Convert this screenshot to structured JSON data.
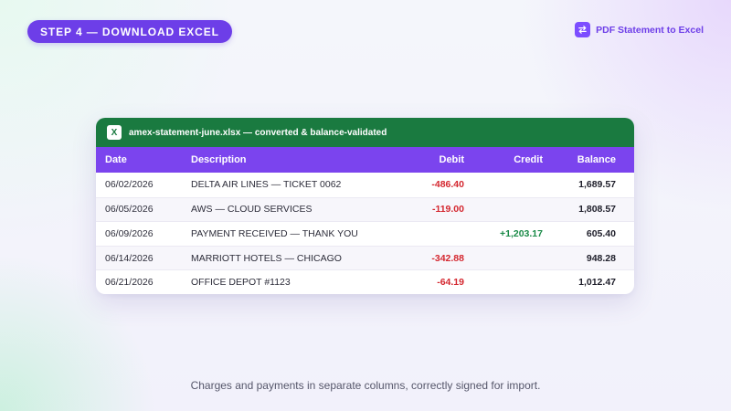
{
  "step_label": "STEP 4 — DOWNLOAD EXCEL",
  "brand": {
    "label": "PDF Statement to Excel",
    "icon": "swap-arrows-icon"
  },
  "file": {
    "icon_letter": "X",
    "name": "amex-statement-june.xlsx — converted & balance-validated"
  },
  "columns": [
    "Date",
    "Description",
    "Debit",
    "Credit",
    "Balance"
  ],
  "rows": [
    {
      "date": "06/02/2026",
      "description": "DELTA AIR LINES — TICKET 0062",
      "debit": "-486.40",
      "credit": "",
      "balance": "1,689.57"
    },
    {
      "date": "06/05/2026",
      "description": "AWS — CLOUD SERVICES",
      "debit": "-119.00",
      "credit": "",
      "balance": "1,808.57"
    },
    {
      "date": "06/09/2026",
      "description": "PAYMENT RECEIVED — THANK YOU",
      "debit": "",
      "credit": "+1,203.17",
      "balance": "605.40"
    },
    {
      "date": "06/14/2026",
      "description": "MARRIOTT HOTELS — CHICAGO",
      "debit": "-342.88",
      "credit": "",
      "balance": "948.28"
    },
    {
      "date": "06/21/2026",
      "description": "OFFICE DEPOT #1123",
      "debit": "-64.19",
      "credit": "",
      "balance": "1,012.47"
    }
  ],
  "caption": "Charges and payments in separate columns, correctly signed for import.",
  "colors": {
    "accent": "#6d3ee8",
    "excel_green": "#1a7a40",
    "debit": "#d4272f",
    "credit": "#1a8a47"
  }
}
